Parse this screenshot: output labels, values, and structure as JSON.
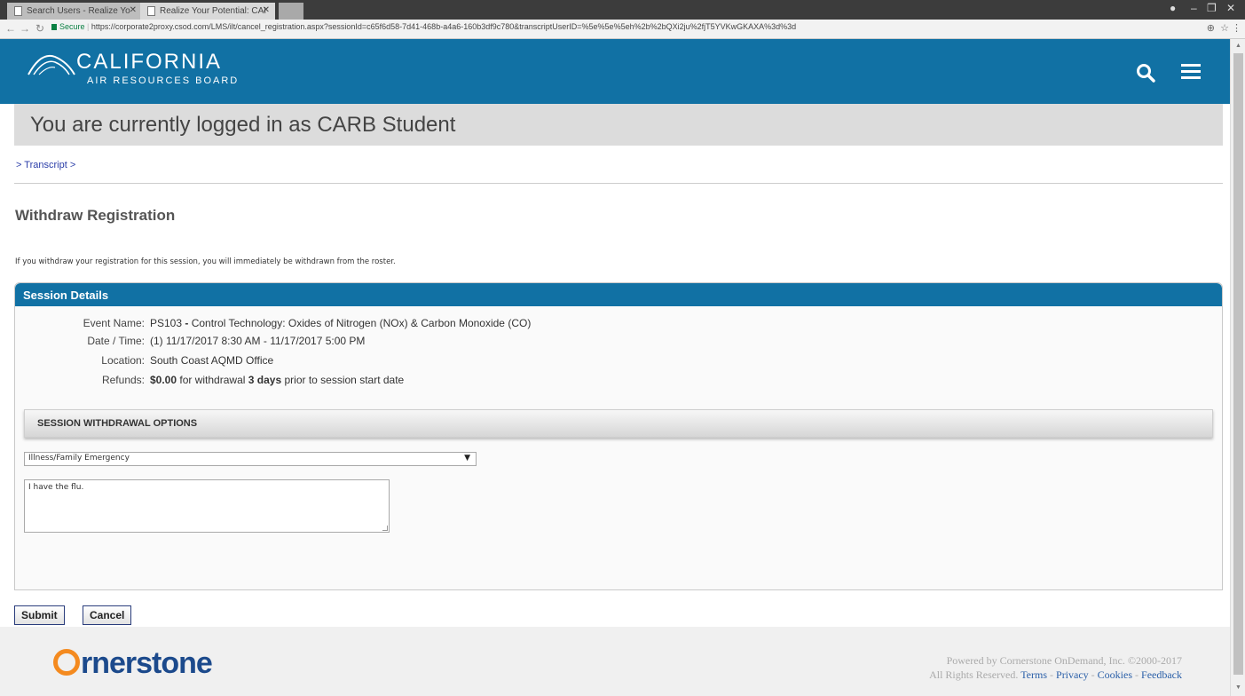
{
  "browser": {
    "tabs": [
      {
        "title": "Search Users - Realize Yo"
      },
      {
        "title": "Realize Your Potential: CAI"
      }
    ],
    "url": {
      "secure_label": "Secure",
      "address": "https://corporate2proxy.csod.com/LMS/ilt/cancel_registration.aspx?sessionId=c65f6d58-7d41-468b-a4a6-160b3df9c780&transcriptUserID=%5e%5e%5eh%2b%2bQXi2ju%2fjT5YVKwGKAXA%3d%3d"
    }
  },
  "header": {
    "logo_title": "CALIFORNIA",
    "logo_subtitle": "AIR RESOURCES BOARD"
  },
  "welcome": {
    "text": "You are currently logged in as CARB Student"
  },
  "breadcrumb": {
    "prefix": ">",
    "link": "Transcript",
    "suffix": ">"
  },
  "page": {
    "title": "Withdraw Registration",
    "intro": "If you withdraw your registration for this session, you will immediately be withdrawn from the roster."
  },
  "session_details": {
    "heading": "Session Details",
    "event_name_label": "Event Name:",
    "event_name_code": "PS103",
    "event_name_sep": " - ",
    "event_name_value": "Control Technology: Oxides of Nitrogen (NOx) & Carbon Monoxide (CO)",
    "datetime_label": "Date / Time:",
    "datetime_value": "(1) 11/17/2017 8:30 AM - 11/17/2017 5:00 PM",
    "location_label": "Location:",
    "location_value": "South Coast AQMD Office",
    "refunds_label": "Refunds:",
    "refunds_amount": "$0.00",
    "refunds_mid": "for withdrawal",
    "refunds_days_num": "3",
    "refunds_days_word": "days",
    "refunds_end": "prior to session start date"
  },
  "withdrawal": {
    "heading": "SESSION WITHDRAWAL OPTIONS",
    "reason_selected": "Illness/Family Emergency",
    "comment": "I have the flu."
  },
  "buttons": {
    "submit": "Submit",
    "cancel": "Cancel"
  },
  "footer": {
    "logo_text": "rnerstone",
    "line1": "Powered by Cornerstone OnDemand, Inc. ©2000-2017",
    "line2_prefix": "All Rights Reserved.",
    "terms": "Terms",
    "privacy": "Privacy",
    "cookies": "Cookies",
    "feedback": "Feedback"
  },
  "colors": {
    "brand": "#1171a4",
    "link": "#2a3da8",
    "accent": "#f48a1f"
  }
}
